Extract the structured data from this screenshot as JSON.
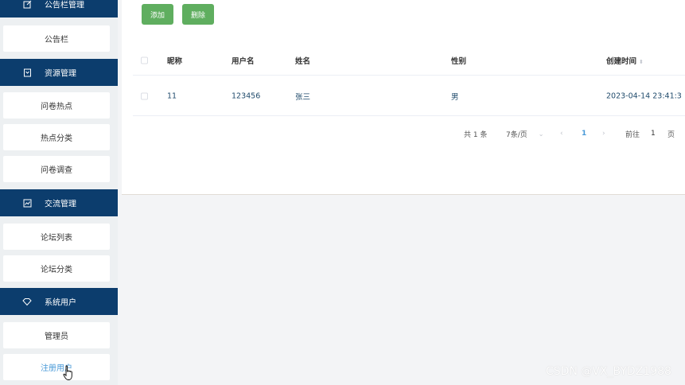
{
  "sidebar": {
    "groups": [
      {
        "label": "公告栏管理",
        "icon": "edit-icon"
      },
      {
        "label": "资源管理",
        "icon": "bookmark-icon"
      },
      {
        "label": "交流管理",
        "icon": "chart-icon"
      },
      {
        "label": "系统用户",
        "icon": "diamond-icon"
      }
    ],
    "items": [
      {
        "label": "公告栏"
      },
      {
        "label": "问卷热点"
      },
      {
        "label": "热点分类"
      },
      {
        "label": "问卷调查"
      },
      {
        "label": "论坛列表"
      },
      {
        "label": "论坛分类"
      },
      {
        "label": "管理员"
      },
      {
        "label": "注册用户",
        "active": true
      }
    ]
  },
  "toolbar": {
    "add_label": "添加",
    "delete_label": "删除",
    "button_color": "#5fae5f"
  },
  "table": {
    "columns": [
      "昵称",
      "用户名",
      "姓名",
      "性别",
      "创建时间"
    ],
    "sort_icon": "sort-icon",
    "rows": [
      {
        "nickname": "11",
        "username": "123456",
        "name": "张三",
        "gender": "男",
        "created": "2023-04-14 23:41:3"
      }
    ]
  },
  "pagination": {
    "total": "共 1 条",
    "page_size": "7条/页",
    "current_page": "1",
    "goto_label": "前往",
    "goto_value": "1",
    "page_unit": "页"
  },
  "watermark": "CSDN @VX_BYDZ1988",
  "colors": {
    "sidebar_header": "#0c3d6d",
    "active_item": "#4a9ad8",
    "background": "#f3f4f6"
  }
}
